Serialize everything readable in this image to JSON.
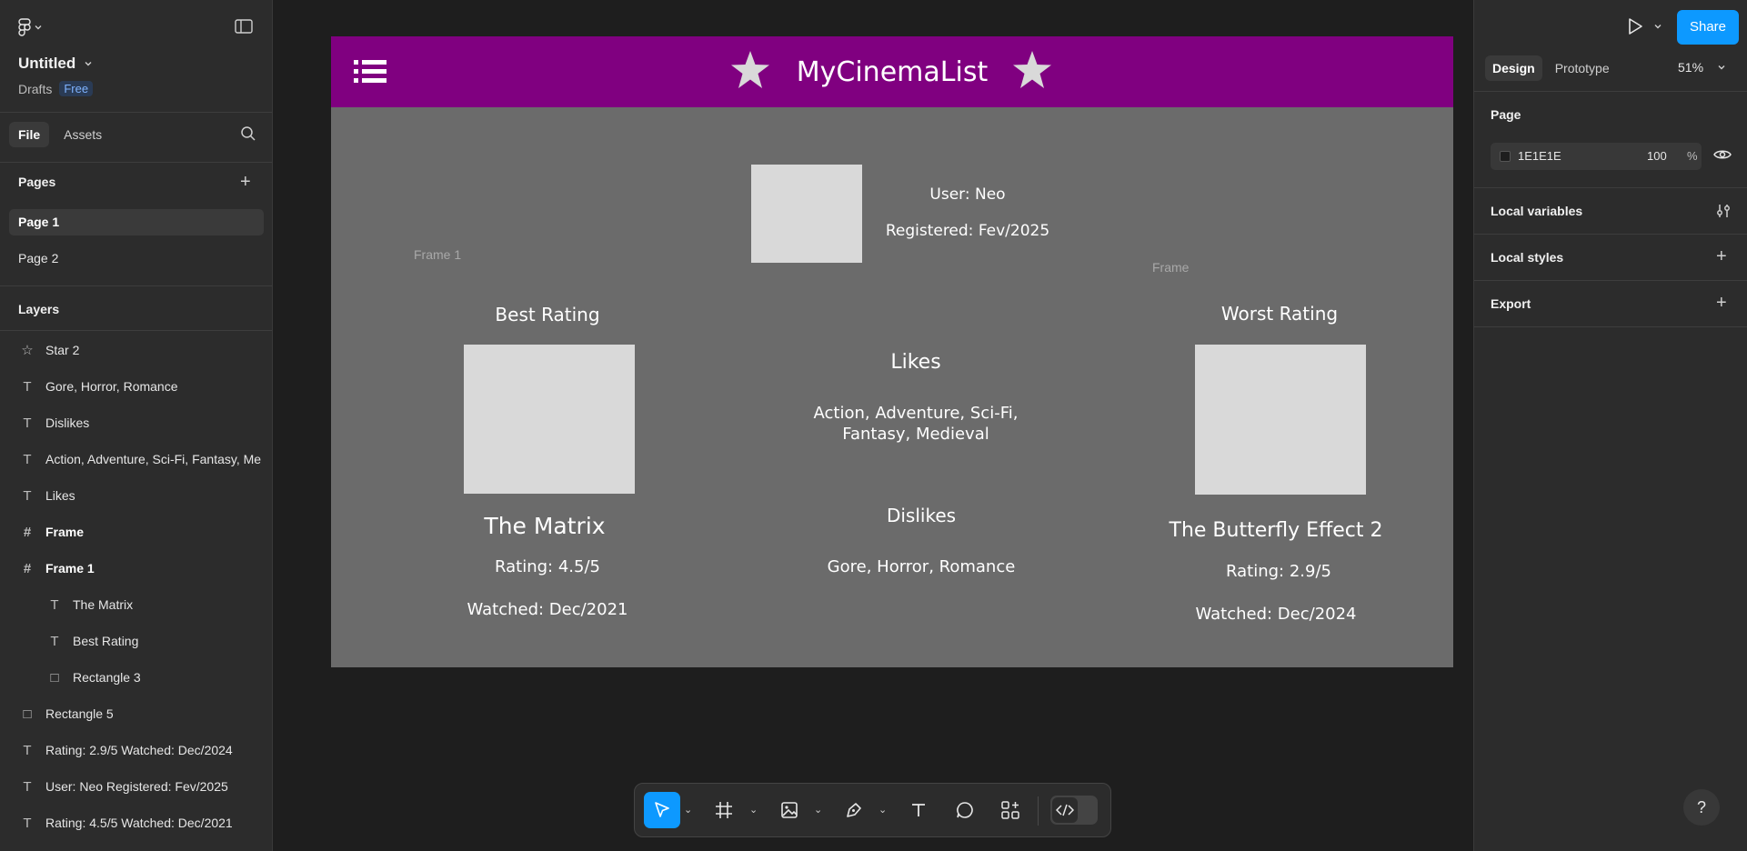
{
  "file": {
    "title": "Untitled",
    "location": "Drafts",
    "plan": "Free"
  },
  "left_tabs": [
    "File",
    "Assets"
  ],
  "pages": {
    "heading": "Pages",
    "items": [
      "Page 1",
      "Page 2"
    ]
  },
  "layers": {
    "heading": "Layers",
    "items": [
      {
        "label": "Star 2",
        "icon": "star-icon"
      },
      {
        "label": "Gore, Horror, Romance",
        "icon": "text-icon"
      },
      {
        "label": "Dislikes",
        "icon": "text-icon"
      },
      {
        "label": "Action, Adventure, Sci-Fi, Fantasy, Me",
        "icon": "text-icon"
      },
      {
        "label": "Likes",
        "icon": "text-icon"
      },
      {
        "label": "Frame",
        "icon": "frame-icon"
      },
      {
        "label": "Frame 1",
        "icon": "frame-icon"
      },
      {
        "label": "The Matrix",
        "icon": "text-icon"
      },
      {
        "label": "Best Rating",
        "icon": "text-icon"
      },
      {
        "label": "Rectangle 3",
        "icon": "rectangle-icon"
      },
      {
        "label": "Rectangle 5",
        "icon": "rectangle-icon"
      },
      {
        "label": "Rating: 2.9/5 Watched: Dec/2024",
        "icon": "text-icon"
      },
      {
        "label": "User: Neo Registered: Fev/2025",
        "icon": "text-icon"
      },
      {
        "label": "Rating: 4.5/5 Watched: Dec/2021",
        "icon": "text-icon"
      }
    ]
  },
  "design": {
    "app_title": "MyCinemaList",
    "accent_color": "#800080",
    "frame_labels": {
      "frame1": "Frame 1",
      "frame": "Frame"
    },
    "user": {
      "name": "User: Neo",
      "registered": "Registered: Fev/2025"
    },
    "best": {
      "heading": "Best Rating",
      "movie": "The Matrix",
      "rating": "Rating: 4.5/5",
      "watched": "Watched: Dec/2021"
    },
    "likes": {
      "heading": "Likes",
      "line1": "Action, Adventure, Sci-Fi,",
      "line2": "Fantasy, Medieval"
    },
    "dislikes": {
      "heading": "Dislikes",
      "list": "Gore, Horror, Romance"
    },
    "worst": {
      "heading": "Worst Rating",
      "movie": "The Butterfly Effect 2",
      "rating": "Rating: 2.9/5",
      "watched": "Watched: Dec/2024"
    }
  },
  "right_panel": {
    "share_label": "Share",
    "tabs": [
      "Design",
      "Prototype"
    ],
    "zoom": "51%",
    "page_heading": "Page",
    "page_color": "1E1E1E",
    "page_opacity": "100",
    "opacity_unit": "%",
    "sections": [
      "Local variables",
      "Local styles",
      "Export"
    ],
    "help": "?"
  },
  "toolbar": [
    "move-tool",
    "frame-tool",
    "image-tool",
    "pen-tool",
    "text-tool",
    "comment-tool",
    "actions-tool",
    "dev-mode-toggle"
  ]
}
